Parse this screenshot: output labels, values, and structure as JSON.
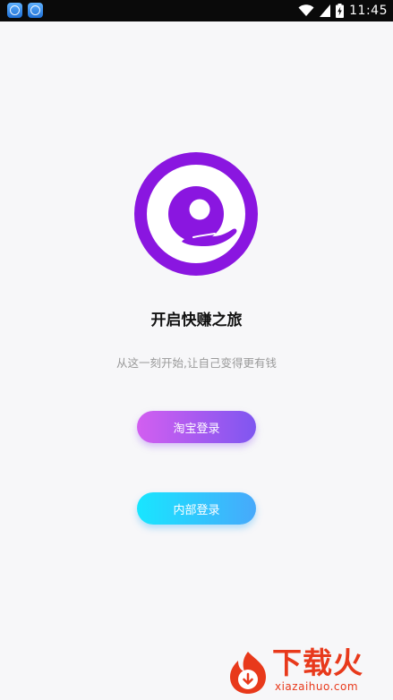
{
  "status_bar": {
    "time": "11:45",
    "notification_icons": [
      "app-notification-icon",
      "app-notification-icon"
    ],
    "indicators": [
      "wifi-icon",
      "signal-icon",
      "battery-charging-icon"
    ]
  },
  "logo": {
    "icon": "app-logo-icon",
    "color": "#8a16e0"
  },
  "title": "开启快赚之旅",
  "subtitle": "从这一刻开始,让自己变得更有钱",
  "buttons": {
    "taobao_login": "淘宝登录",
    "internal_login": "内部登录"
  },
  "colors": {
    "taobao_gradient": [
      "#d25ff0",
      "#7f56f0"
    ],
    "internal_gradient": [
      "#18e6ff",
      "#47a9fb"
    ],
    "watermark": "#e8391b"
  },
  "watermark": {
    "text": "下载火",
    "domain": "xiazaihuo.com"
  }
}
